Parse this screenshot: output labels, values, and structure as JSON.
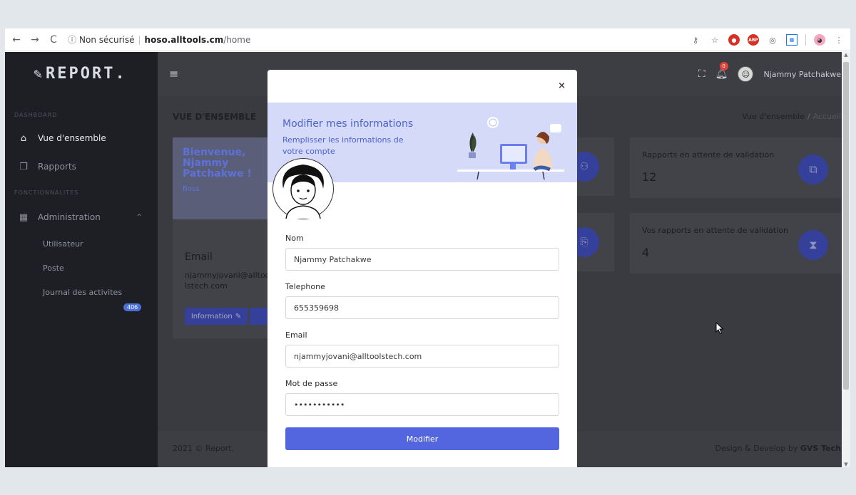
{
  "browser": {
    "url_security": "Non sécurisé",
    "url_host": "hoso.alltools.cm",
    "url_path": "/home",
    "ext_abp_label": "ABP"
  },
  "sidebar": {
    "logo": "REPORT.",
    "section_dashboard": "DASHBOARD",
    "section_features": "FONCTIONNALITES",
    "items": [
      {
        "label": "Vue d'ensemble",
        "icon": "home-icon"
      },
      {
        "label": "Rapports",
        "icon": "copy-icon"
      },
      {
        "label": "Administration",
        "icon": "grid-icon"
      }
    ],
    "subitems": [
      {
        "label": "Utilisateur"
      },
      {
        "label": "Poste"
      },
      {
        "label": "Journal des activites"
      }
    ],
    "journal_badge": "406"
  },
  "topbar": {
    "notifications_count": "0",
    "user_name": "Njammy Patchakwe"
  },
  "page": {
    "title": "VUE D'ENSEMBLE",
    "breadcrumb": [
      "Vue d'ensemble",
      "Accueil"
    ]
  },
  "profile_card": {
    "welcome": "Bienvenue, Njammy Patchakwe !",
    "role": "Boss",
    "email_label": "Email",
    "email_value": "njammyjovani@alltoolstech.com",
    "info_button": "Information"
  },
  "stats": [
    {
      "label": "Rapports en attente de validation",
      "value": "12"
    },
    {
      "label": "Vos rapports en attente de validation",
      "value": "4"
    }
  ],
  "footer": {
    "left": "2021 © Report.",
    "right_prefix": "Design & Develop by ",
    "right_brand": "GVS Tech"
  },
  "modal": {
    "close": "×",
    "title": "Modifier mes informations",
    "subtitle": "Remplisser les informations de votre compte",
    "fields": [
      {
        "label": "Nom",
        "value": "Njammy Patchakwe"
      },
      {
        "label": "Telephone",
        "value": "655359698"
      },
      {
        "label": "Email",
        "value": "njammyjovani@alltoolstech.com"
      },
      {
        "label": "Mot de passe",
        "value": "•••••••••••"
      }
    ],
    "submit": "Modifier"
  },
  "colors": {
    "accent": "#5465e0",
    "banner": "#d5daf8",
    "sidebar": "#1e1f24",
    "badge": "#e0433a"
  }
}
